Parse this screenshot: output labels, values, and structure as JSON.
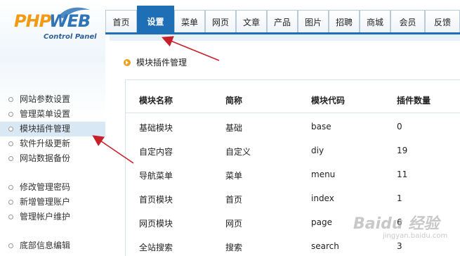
{
  "logo": {
    "php": "PHP",
    "web": "WEB",
    "subtitle": "Control Panel"
  },
  "nav": {
    "tabs": [
      "首页",
      "设置",
      "菜单",
      "网页",
      "文章",
      "产品",
      "图片",
      "招聘",
      "商城",
      "会员",
      "反馈"
    ],
    "active_index": 1
  },
  "sidebar": {
    "items": [
      {
        "label": "网站参数设置",
        "active": false
      },
      {
        "label": "管理菜单设置",
        "active": false
      },
      {
        "label": "模块插件管理",
        "active": true
      },
      {
        "label": "软件升级更新",
        "active": false
      },
      {
        "label": "网站数据备份",
        "active": false
      },
      {
        "label": "修改管理密码",
        "active": false
      },
      {
        "label": "新增管理账户",
        "active": false
      },
      {
        "label": "管理帐户维护",
        "active": false
      },
      {
        "label": "底部信息编辑",
        "active": false
      }
    ]
  },
  "breadcrumb": "模块插件管理",
  "table": {
    "headers": [
      "模块名称",
      "简称",
      "模块代码",
      "插件数量"
    ],
    "rows": [
      [
        "基础模块",
        "基础",
        "base",
        "0"
      ],
      [
        "自定内容",
        "自定义",
        "diy",
        "19"
      ],
      [
        "导航菜单",
        "菜单",
        "menu",
        "11"
      ],
      [
        "首页模块",
        "首页",
        "index",
        "1"
      ],
      [
        "网页模块",
        "网页",
        "page",
        "6"
      ],
      [
        "全站搜索",
        "搜索",
        "search",
        "3"
      ]
    ]
  },
  "watermark": {
    "main": "Baidu 经验",
    "sub": "jingyan.baidu.com"
  },
  "colors": {
    "accent": "#1f6fb6",
    "arrow": "#c8202a",
    "logo_orange": "#f29a12",
    "logo_blue": "#2f74b8"
  }
}
